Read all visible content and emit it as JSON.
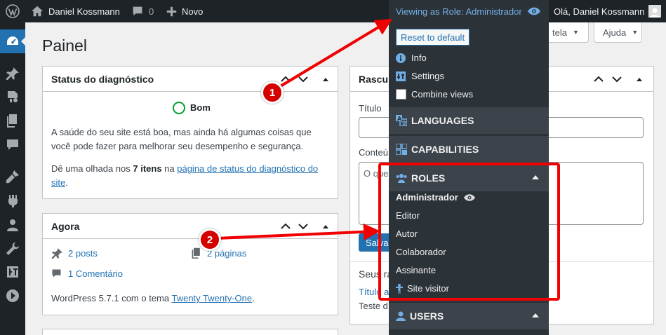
{
  "admin_bar": {
    "site_name": "Daniel Kossmann",
    "comments_count": "0",
    "new_label": "Novo",
    "greeting": "Olá, Daniel Kossmann",
    "viewing_as": "Viewing as Role: Administrador"
  },
  "page": {
    "title": "Painel",
    "screen_options": "tela",
    "help": "Ajuda"
  },
  "site_health": {
    "title": "Status do diagnóstico",
    "status": "Bom",
    "line1": "A saúde do seu site está boa, mas ainda há algumas coisas que",
    "line2": "você pode fazer para melhorar seu desempenho e segurança.",
    "look_prefix": "Dê uma olhada nos ",
    "items_count": "7 itens",
    "look_mid": " na ",
    "link_part1": "página de status do diagnóstico do",
    "link_part2": "site",
    "period": "."
  },
  "glance": {
    "title": "Agora",
    "posts": "2 posts",
    "pages": "2 páginas",
    "comments": "1 Comentário",
    "version_prefix": "WordPress 5.7.1 com o tema ",
    "theme": "Twenty Twenty-One",
    "period": "."
  },
  "quick_draft": {
    "title_partial": "Rascun",
    "title_label": "Título",
    "content_label": "Conteú",
    "content_placeholder": "O que",
    "save_label": "Salva",
    "recent_label": "Seus ra",
    "recent_link": "Título a",
    "recent_test": "Teste d"
  },
  "vaa": {
    "reset": "Reset to default",
    "info": "Info",
    "settings": "Settings",
    "combine": "Combine views",
    "languages": "LANGUAGES",
    "capabilities": "CAPABILITIES",
    "roles": "ROLES",
    "roles_list": [
      "Administrador",
      "Editor",
      "Autor",
      "Colaborador",
      "Assinante"
    ],
    "site_visitor": "Site visitor",
    "users": "USERS"
  },
  "annotations": {
    "badge1": "1",
    "badge2": "2"
  },
  "colors": {
    "annotation_red": "#f00000",
    "accent_blue": "#2271b1",
    "link_blue": "#72aee6"
  }
}
